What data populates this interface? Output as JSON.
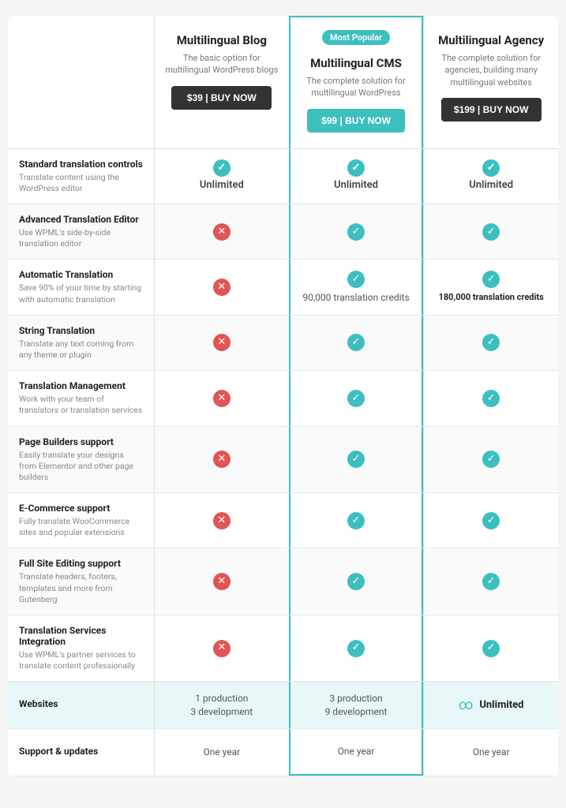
{
  "plans": [
    {
      "id": "blog",
      "name": "Multilingual Blog",
      "desc": "The basic option for multilingual WordPress blogs",
      "price": "$39 | BUY NOW",
      "btnStyle": "dark",
      "featured": false
    },
    {
      "id": "cms",
      "name": "Multilingual CMS",
      "desc": "The complete solution for multilingual WordPress",
      "price": "$99 | BUY NOW",
      "btnStyle": "teal",
      "featured": true,
      "badge": "Most Popular"
    },
    {
      "id": "agency",
      "name": "Multilingual Agency",
      "desc": "The complete solution for agencies, building many multilingual websites",
      "price": "$199 | BUY NOW",
      "btnStyle": "dark",
      "featured": false
    }
  ],
  "features": [
    {
      "title": "Standard translation controls",
      "desc": "Translate content using the WordPress editor",
      "blog": "unlimited",
      "cms": "unlimited",
      "agency": "unlimited"
    },
    {
      "title": "Advanced Translation Editor",
      "desc": "Use WPML's side-by-side translation editor",
      "blog": "cross",
      "cms": "check",
      "agency": "check"
    },
    {
      "title": "Automatic Translation",
      "desc": "Save 90% of your time by starting with automatic translation",
      "blog": "cross",
      "cms": "90,000 translation credits",
      "agency": "180,000 translation credits"
    },
    {
      "title": "String Translation",
      "desc": "Translate any text coming from any theme or plugin",
      "blog": "cross",
      "cms": "check",
      "agency": "check"
    },
    {
      "title": "Translation Management",
      "desc": "Work with your team of translators or translation services",
      "blog": "cross",
      "cms": "check",
      "agency": "check"
    },
    {
      "title": "Page Builders support",
      "desc": "Easily translate your designs from Elementor and other page builders",
      "blog": "cross",
      "cms": "check",
      "agency": "check"
    },
    {
      "title": "E-Commerce support",
      "desc": "Fully translate WooCommerce sites and popular extensions",
      "blog": "cross",
      "cms": "check",
      "agency": "check"
    },
    {
      "title": "Full Site Editing support",
      "desc": "Translate headers, footers, templates and more from Gutenberg",
      "blog": "cross",
      "cms": "check",
      "agency": "check"
    },
    {
      "title": "Translation Services Integration",
      "desc": "Use WPML's partner services to translate content professionally",
      "blog": "cross",
      "cms": "check",
      "agency": "check"
    },
    {
      "title": "Websites",
      "desc": "",
      "blog": "1 production\n3 development",
      "cms": "3 production\n9 development",
      "agency": "unlimited-special",
      "highlight": true
    },
    {
      "title": "Support & updates",
      "desc": "",
      "blog": "One year",
      "cms": "One year",
      "agency": "One year"
    }
  ],
  "labels": {
    "unlimited": "Unlimited",
    "check_char": "✓",
    "cross_char": "✕",
    "infinity": "∞"
  }
}
